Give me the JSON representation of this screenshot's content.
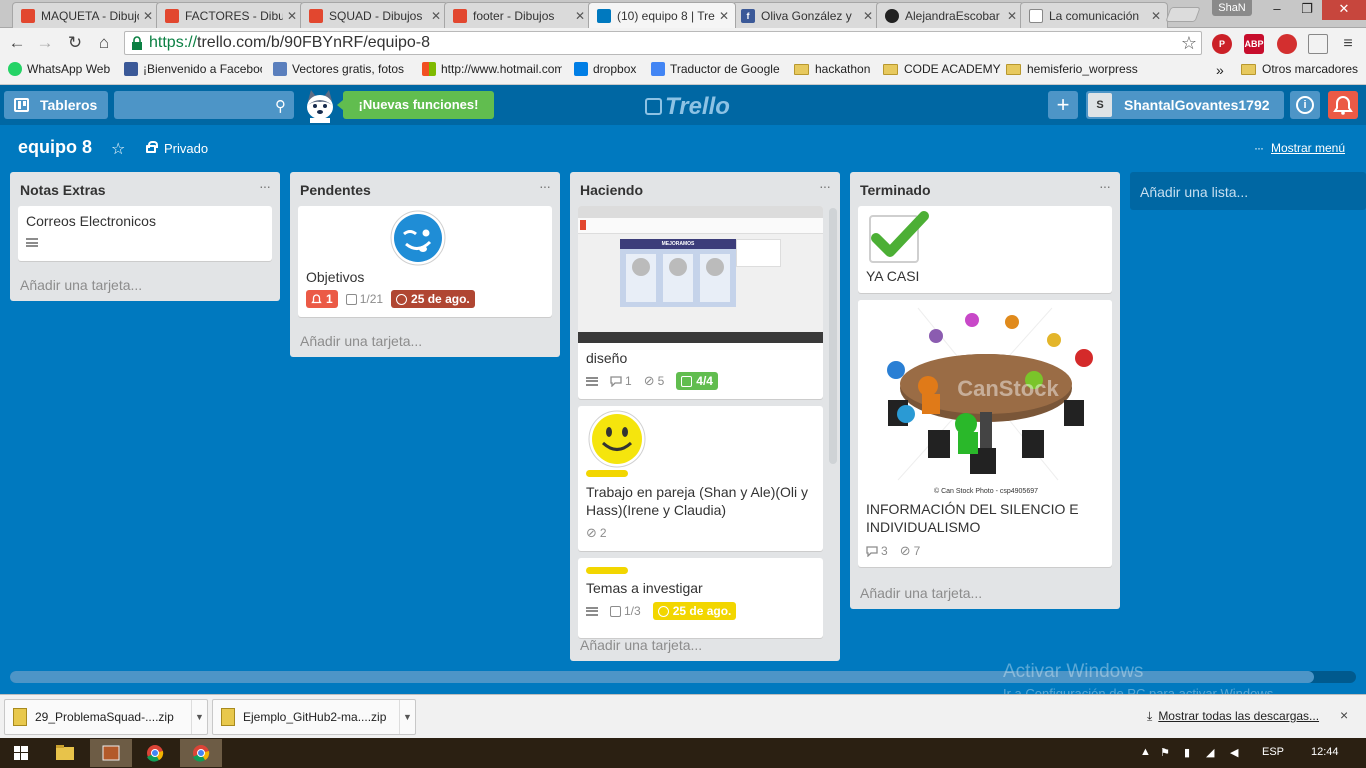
{
  "browser": {
    "tabs": [
      {
        "title": "MAQUETA - Dibujos",
        "favicon_color": "#e2472f",
        "active": false
      },
      {
        "title": "FACTORES - Dibujos",
        "favicon_color": "#e2472f",
        "active": false
      },
      {
        "title": "SQUAD - Dibujos",
        "favicon_color": "#e2472f",
        "active": false
      },
      {
        "title": "footer - Dibujos",
        "favicon_color": "#e2472f",
        "active": false
      },
      {
        "title": "(10) equipo 8 | Trello",
        "favicon_color": "#0079bf",
        "active": true
      },
      {
        "title": "Oliva González y",
        "favicon_color": "#3b5998",
        "active": false
      },
      {
        "title": "AlejandraEscobar",
        "favicon_color": "#222222",
        "active": false
      },
      {
        "title": "La comunicación",
        "favicon_color": "#ffffff",
        "active": false
      }
    ],
    "profile_name": "ShaN",
    "url_scheme": "https://",
    "url_rest": "trello.com/b/90FBYnRF/equipo-8",
    "bookmarks": [
      {
        "label": "WhatsApp Web",
        "icon": "whatsapp-icon",
        "color": "#25d366"
      },
      {
        "label": "¡Bienvenido a Facebook",
        "icon": "facebook-icon",
        "color": "#3b5998"
      },
      {
        "label": "Vectores gratis, fotos",
        "icon": "freepik-icon",
        "color": "#5a7fbd"
      },
      {
        "label": "http://www.hotmail.com",
        "icon": "windows-icon",
        "color": "#f25022"
      },
      {
        "label": "dropbox",
        "icon": "dropbox-icon",
        "color": "#007ee5"
      },
      {
        "label": "Traductor de Google",
        "icon": "translate-icon",
        "color": "#4285f4"
      },
      {
        "label": "hackathon",
        "icon": "folder-icon",
        "color": "#e7c95e"
      },
      {
        "label": "CODE ACADEMY",
        "icon": "folder-icon",
        "color": "#e7c95e"
      },
      {
        "label": "hemisferio_worpress",
        "icon": "folder-icon",
        "color": "#e7c95e"
      }
    ],
    "bookmarks_overflow": "»",
    "other_bookmarks": "Otros marcadores"
  },
  "trello": {
    "boards_label": "Tableros",
    "new_features": "¡Nuevas funciones!",
    "logo": "Trello",
    "username": "ShantalGovantes1792",
    "avatar_initial": "S",
    "board_title": "equipo 8",
    "privacy": "Privado",
    "show_menu": "Mostrar menú",
    "dots": "···",
    "add_list": "Añadir una lista...",
    "lists": [
      {
        "title": "Notas Extras",
        "add_card": "Añadir una tarjeta...",
        "cards": [
          {
            "title": "Correos Electronicos"
          }
        ]
      },
      {
        "title": "Pendentes",
        "add_card": "Añadir una tarjeta...",
        "cards": [
          {
            "title": "Objetivos",
            "badges": {
              "notifications": "1",
              "checklist": "1/21",
              "due": "25 de ago."
            }
          }
        ]
      },
      {
        "title": "Haciendo",
        "add_card": "Añadir una tarjeta...",
        "cards": [
          {
            "title": "diseño",
            "cover_caption": "MEJORAMOS",
            "badges": {
              "comments": "1",
              "attachments": "5",
              "checklist": "4/4"
            }
          },
          {
            "title": "Trabajo en pareja (Shan y Ale)(Oli y Hass)(Irene y Claudia)",
            "badges": {
              "attachments": "2"
            }
          },
          {
            "title": "Temas a investigar",
            "badges": {
              "checklist": "1/3",
              "due": "25 de ago."
            }
          }
        ]
      },
      {
        "title": "Terminado",
        "add_card": "Añadir una tarjeta...",
        "cards": [
          {
            "title": "YA CASI"
          },
          {
            "title": "INFORMACIÓN DEL SILENCIO E INDIVIDUALISMO",
            "cover_watermark": "CanStock",
            "cover_caption": "© Can Stock Photo - csp4905697",
            "badges": {
              "comments": "3",
              "attachments": "7"
            }
          }
        ]
      }
    ]
  },
  "watermark": {
    "line1": "Activar Windows",
    "line2": "Ir a Configuración de PC para activar Windows."
  },
  "downloads": {
    "items": [
      {
        "name": "29_ProblemaSquad-....zip"
      },
      {
        "name": "Ejemplo_GitHub2-ma....zip"
      }
    ],
    "show_all": "Mostrar todas las descargas...",
    "close": "×"
  },
  "taskbar": {
    "language": "ESP",
    "time": "12:44"
  }
}
